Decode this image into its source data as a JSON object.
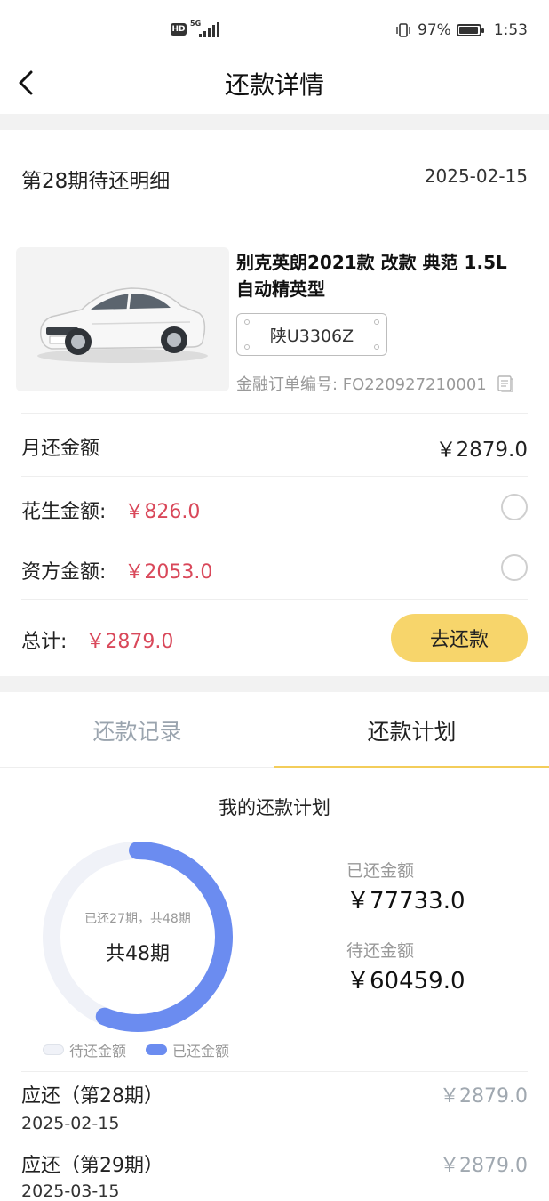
{
  "status_bar": {
    "hd_badge": "HD",
    "signal_label": "5G",
    "battery": "97%",
    "time": "1:53"
  },
  "nav": {
    "title": "还款详情"
  },
  "period": {
    "title": "第28期待还明细",
    "date": "2025-02-15"
  },
  "car": {
    "name": "别克英朗2021款 改款 典范 1.5L 自动精英型",
    "plate": "陕U3306Z",
    "order_no": "金融订单编号: FO220927210001"
  },
  "amounts": {
    "monthly_label": "月还金额",
    "monthly_value": "￥2879.0",
    "huasheng_label": "花生金额:",
    "huasheng_value": "￥826.0",
    "capital_label": "资方金额:",
    "capital_value": "￥2053.0",
    "total_label": "总计:",
    "total_value": "￥2879.0",
    "pay_button": "去还款"
  },
  "tabs": [
    {
      "label": "还款记录",
      "active": false
    },
    {
      "label": "还款计划",
      "active": true
    }
  ],
  "plan": {
    "title": "我的还款计划",
    "progress_text": "已还27期，共48期",
    "total_periods_text": "共48期",
    "paid_periods": 27,
    "total_periods": 48,
    "legend_pending": "待还金额",
    "legend_paid": "已还金额",
    "paid_label": "已还金额",
    "paid_value": "￥77733.0",
    "pending_label": "待还金额",
    "pending_value": "￥60459.0"
  },
  "schedule": [
    {
      "title": "应还（第28期）",
      "date": "2025-02-15",
      "amount": "￥2879.0"
    },
    {
      "title": "应还（第29期）",
      "date": "2025-03-15",
      "amount": "￥2879.0"
    }
  ],
  "colors": {
    "accent_yellow": "#f7d56b",
    "tab_underline": "#f3cd5a",
    "amount_red": "#d9485a",
    "donut_paid": "#6b8cf0",
    "donut_pending": "#f0f2f8"
  },
  "icons": {
    "back": "chevron-left-icon",
    "copy": "copy-icon",
    "vibrate": "vibrate-icon",
    "battery": "battery-icon",
    "signal": "signal-icon"
  }
}
